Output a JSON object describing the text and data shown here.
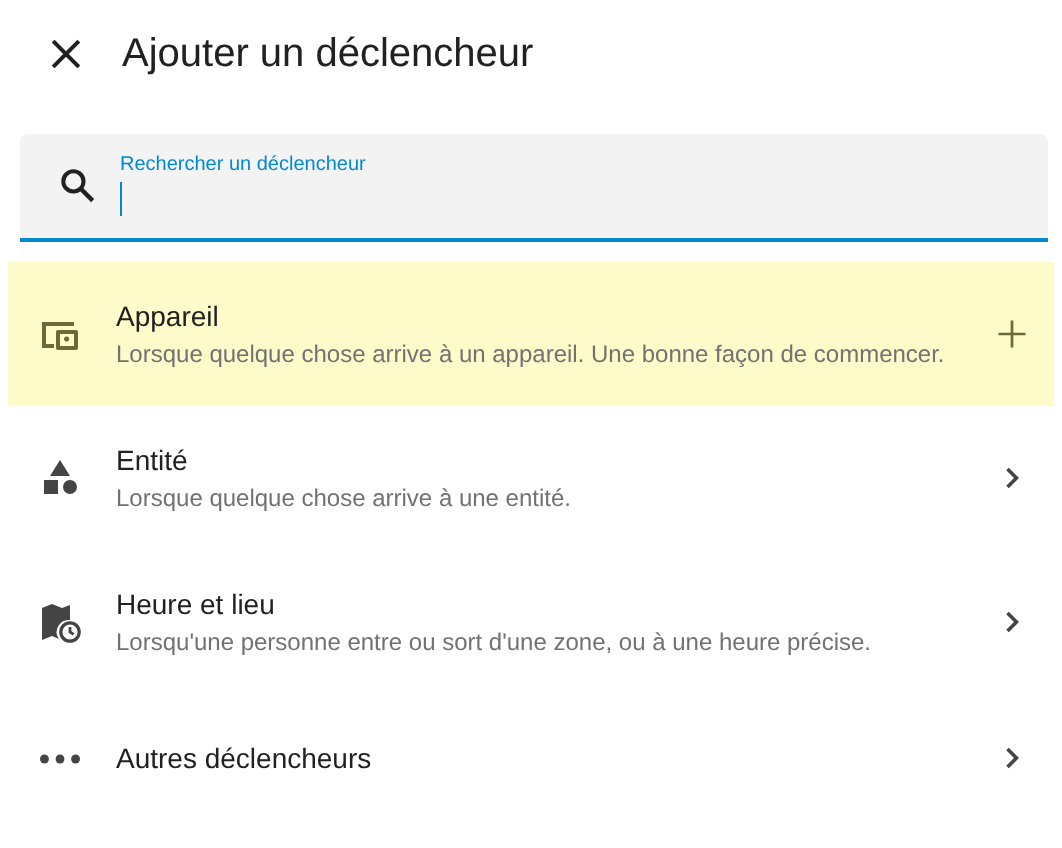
{
  "dialog": {
    "title": "Ajouter un déclencheur"
  },
  "search": {
    "label": "Rechercher un déclencheur"
  },
  "items": [
    {
      "kind": "device",
      "title": "Appareil",
      "description": "Lorsque quelque chose arrive à un appareil. Une bonne façon de commencer.",
      "selected": true,
      "expandable": false
    },
    {
      "kind": "entity",
      "title": "Entité",
      "description": "Lorsque quelque chose arrive à une entité.",
      "selected": false,
      "expandable": true
    },
    {
      "kind": "time-location",
      "title": "Heure et lieu",
      "description": "Lorsqu'une personne entre ou sort d'une zone, ou à une heure précise.",
      "selected": false,
      "expandable": true
    },
    {
      "kind": "other",
      "title": "Autres déclencheurs",
      "selected": false,
      "expandable": true
    }
  ]
}
